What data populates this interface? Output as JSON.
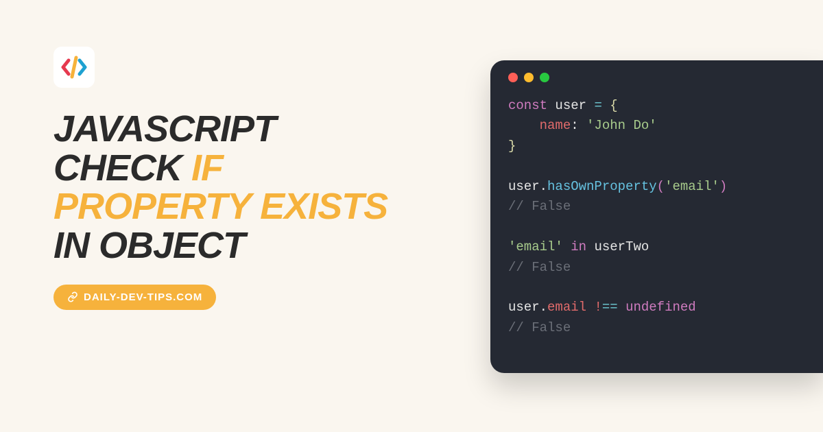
{
  "headline": {
    "parts": [
      {
        "text": "JAVASCRIPT CHECK ",
        "accent": false
      },
      {
        "text": "IF PROPERTY EXISTS",
        "accent": true
      },
      {
        "text": " IN OBJECT",
        "accent": false
      }
    ]
  },
  "badge": {
    "label": "DAILY-DEV-TIPS.COM"
  },
  "code": {
    "tokens": [
      [
        {
          "t": "const ",
          "c": "tok-kw"
        },
        {
          "t": "user ",
          "c": "tok-var"
        },
        {
          "t": "= ",
          "c": "tok-op"
        },
        {
          "t": "{",
          "c": "tok-brace"
        }
      ],
      [
        {
          "t": "    name",
          "c": "tok-prop"
        },
        {
          "t": ": ",
          "c": "tok-var"
        },
        {
          "t": "'John Do'",
          "c": "tok-str"
        }
      ],
      [
        {
          "t": "}",
          "c": "tok-brace"
        }
      ],
      [],
      [
        {
          "t": "user",
          "c": "tok-var"
        },
        {
          "t": ".",
          "c": "tok-var"
        },
        {
          "t": "hasOwnProperty",
          "c": "tok-fn"
        },
        {
          "t": "(",
          "c": "tok-paren"
        },
        {
          "t": "'email'",
          "c": "tok-str"
        },
        {
          "t": ")",
          "c": "tok-paren"
        }
      ],
      [
        {
          "t": "// False",
          "c": "tok-comment"
        }
      ],
      [],
      [
        {
          "t": "'email'",
          "c": "tok-str"
        },
        {
          "t": " in ",
          "c": "tok-kw"
        },
        {
          "t": "userTwo",
          "c": "tok-var"
        }
      ],
      [
        {
          "t": "// False",
          "c": "tok-comment"
        }
      ],
      [],
      [
        {
          "t": "user",
          "c": "tok-var"
        },
        {
          "t": ".",
          "c": "tok-var"
        },
        {
          "t": "email ",
          "c": "tok-prop"
        },
        {
          "t": "!",
          "c": "tok-bang"
        },
        {
          "t": "== ",
          "c": "tok-op"
        },
        {
          "t": "undefined",
          "c": "tok-undef"
        }
      ],
      [
        {
          "t": "// False",
          "c": "tok-comment"
        }
      ]
    ]
  },
  "colors": {
    "background": "#faf6ef",
    "card_bg": "#252933",
    "accent": "#f6b23c",
    "text_dark": "#2b2b2b"
  }
}
